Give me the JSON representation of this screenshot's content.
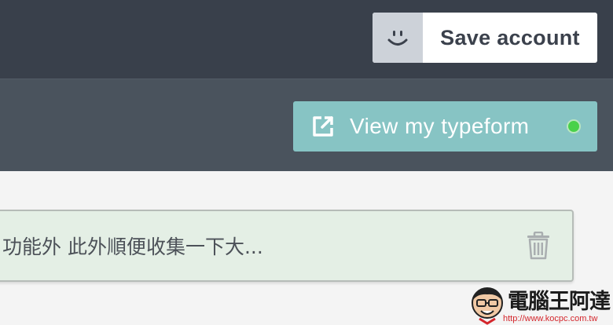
{
  "header": {
    "save_account": {
      "label": "Save account",
      "avatar_icon": "smiley-face-icon"
    }
  },
  "subheader": {
    "view_button": {
      "label": "View my typeform",
      "icon": "external-link-icon",
      "status_color": "#49d14a"
    }
  },
  "content": {
    "field": {
      "text": "功能外 此外順便收集一下大...",
      "delete_icon": "trash-icon"
    }
  },
  "watermark": {
    "title": "電腦王阿達",
    "url": "http://www.kocpc.com.tw"
  },
  "colors": {
    "topbar": "#39404b",
    "subbar": "#4a535d",
    "accent": "#87c4c4",
    "field_bg": "#e4efe5"
  }
}
